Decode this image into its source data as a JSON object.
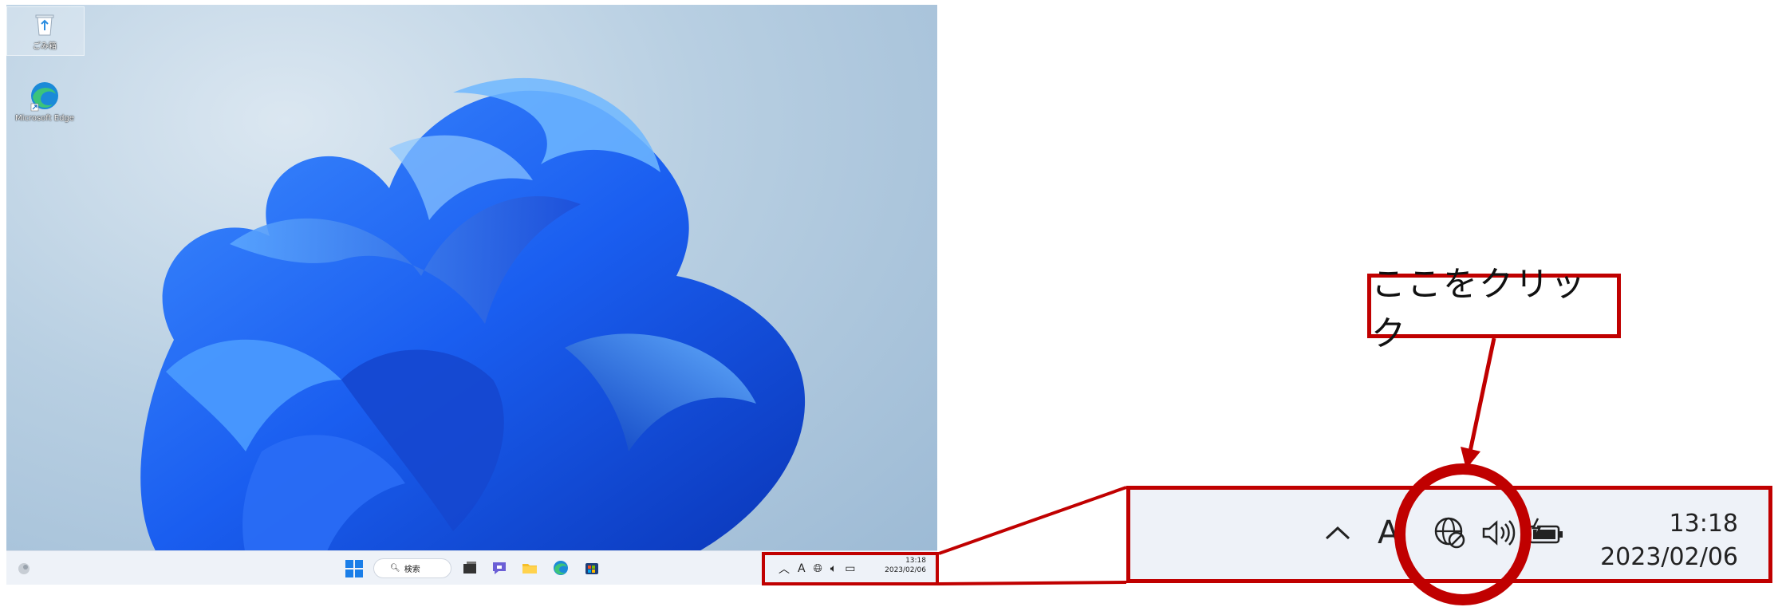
{
  "desktop": {
    "icons": [
      {
        "name": "recycle-bin",
        "label": "ごみ箱"
      },
      {
        "name": "microsoft-edge",
        "label": "Microsoft Edge"
      }
    ],
    "taskbar": {
      "search_label": "検索",
      "tray_time": "13:18",
      "tray_date": "2023/02/06",
      "tray_ime": "A"
    }
  },
  "zoom": {
    "ime": "A",
    "time": "13:18",
    "date": "2023/02/06"
  },
  "callout": {
    "text": "ここをクリック"
  },
  "colors": {
    "annotation": "#c00000",
    "taskbar_bg": "#eef2f8",
    "win_blue": "#0067c0"
  }
}
